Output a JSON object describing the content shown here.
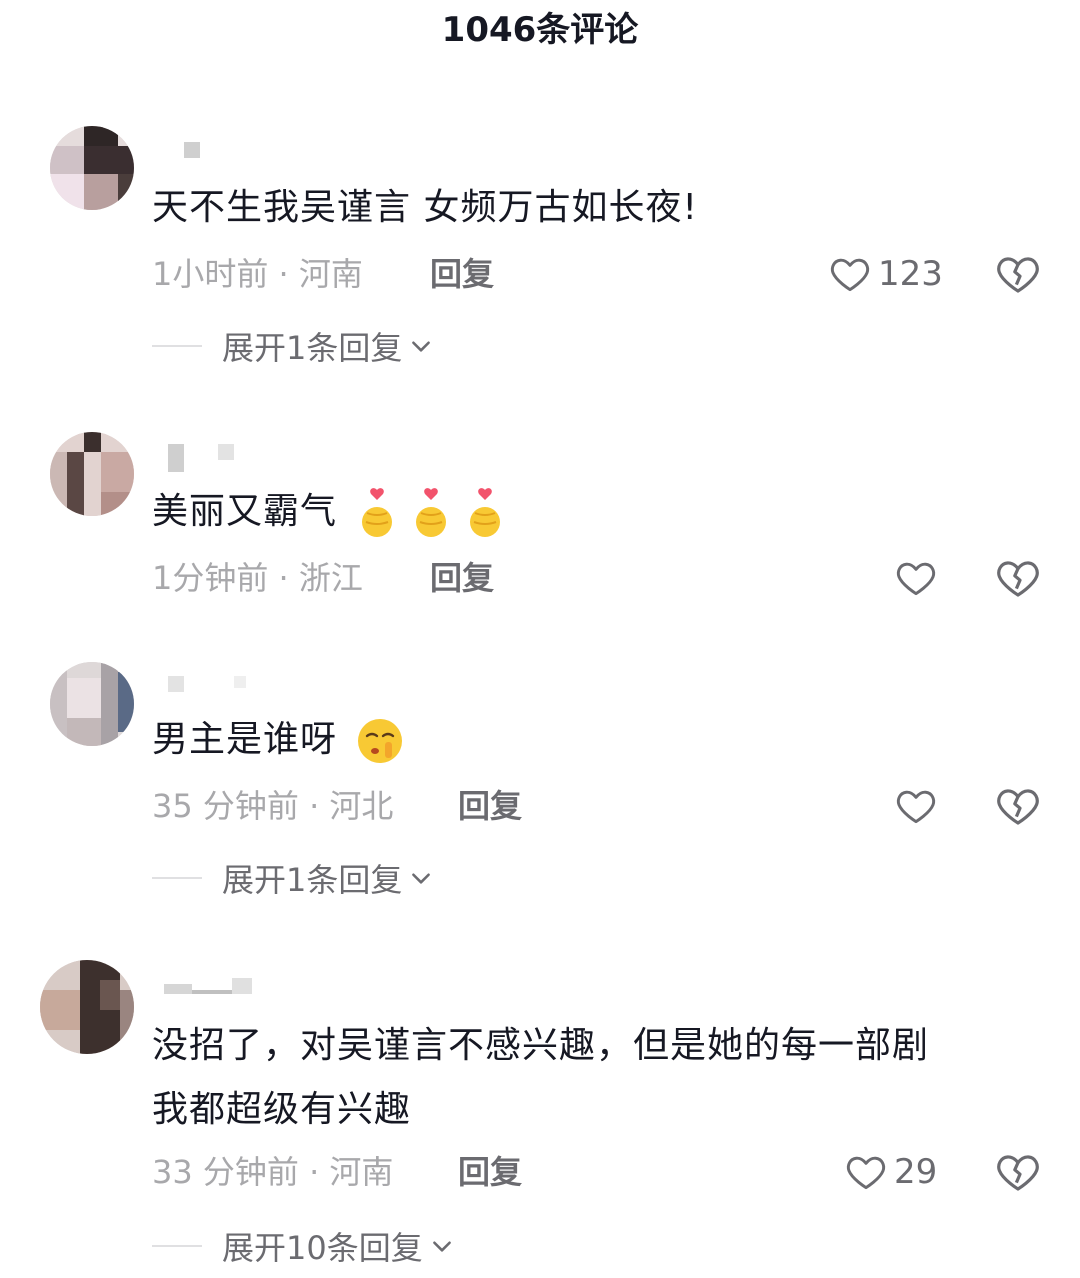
{
  "header": {
    "title": "1046条评论"
  },
  "comments": [
    {
      "content": "天不生我吴谨言 女频万古如长夜!",
      "time_location": "1小时前 · 河南",
      "reply_label": "回复",
      "like_count": "123",
      "expand_label": "展开1条回复"
    },
    {
      "content": "美丽又霸气",
      "emojis": [
        "finger-heart-emoji",
        "finger-heart-emoji",
        "finger-heart-emoji"
      ],
      "time_location": "1分钟前 · 浙江",
      "reply_label": "回复",
      "like_count": ""
    },
    {
      "content": "男主是谁呀",
      "emojis": [
        "shushing-face-emoji"
      ],
      "time_location": "35 分钟前 · 河北",
      "reply_label": "回复",
      "like_count": "",
      "expand_label": "展开1条回复"
    },
    {
      "content_line1": "没招了，对吴谨言不感兴趣，但是她的每一部剧",
      "content_line2": "我都超级有兴趣",
      "time_location": "33 分钟前 · 河南",
      "reply_label": "回复",
      "like_count": "29",
      "expand_label": "展开10条回复"
    }
  ],
  "colors": {
    "primary_text": "#161823",
    "secondary_text": "#a8a8ab",
    "action_text": "#6b6b70"
  }
}
